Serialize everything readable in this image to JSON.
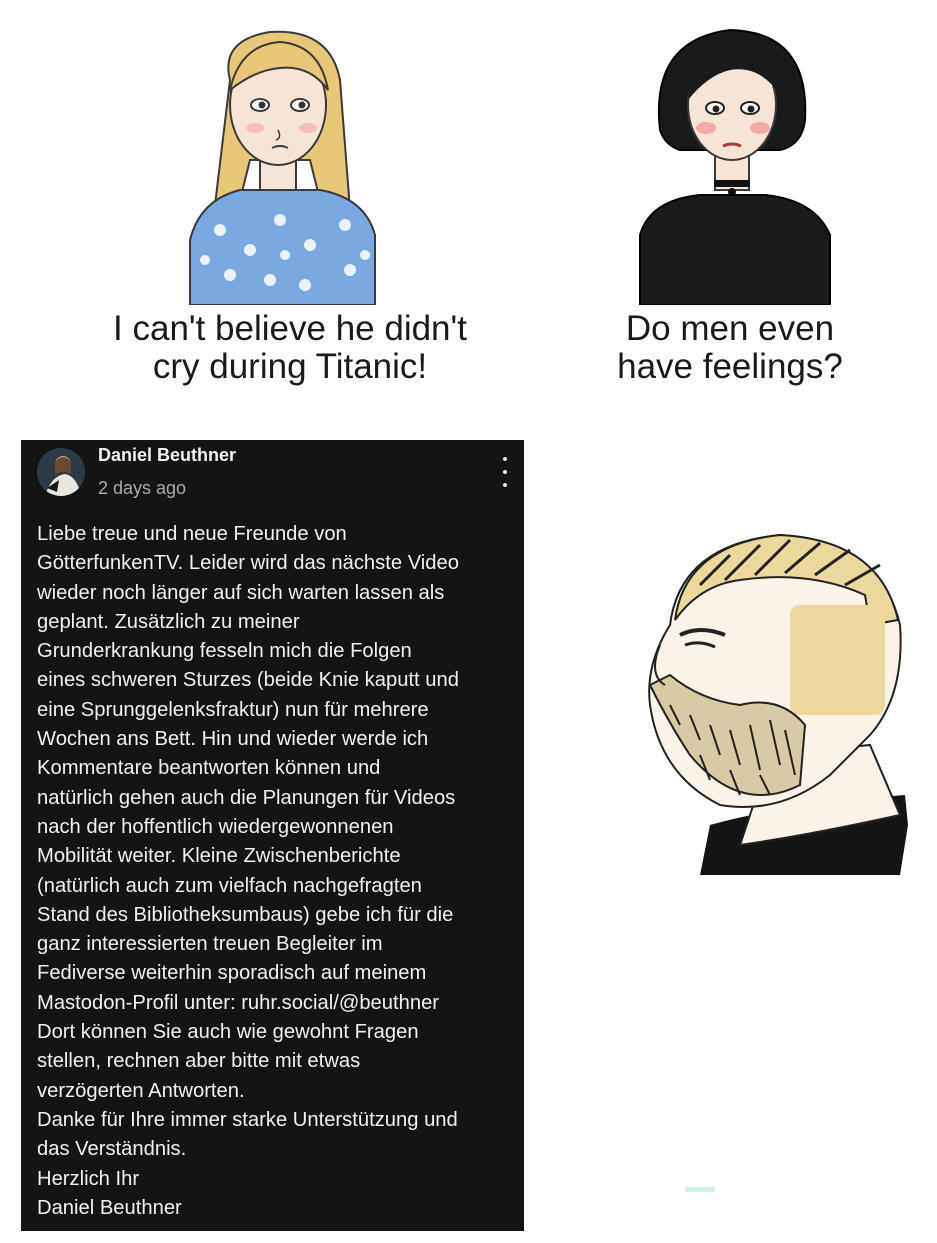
{
  "meme": {
    "panel1_caption": [
      "I can't believe he didn't",
      "cry during Titanic!"
    ],
    "panel2_caption": [
      "Do men even",
      "have feelings?"
    ]
  },
  "post": {
    "author": "Daniel Beuthner",
    "timestamp": "2 days ago",
    "menu_icon": "more-vert-icon",
    "body_lines": [
      "Liebe treue und neue Freunde von",
      "GötterfunkenTV. Leider wird das nächste Video",
      "wieder noch länger auf sich warten lassen als",
      "geplant. Zusätzlich zu meiner",
      "Grunderkrankung fesseln mich die Folgen",
      "eines schweren Sturzes (beide Knie kaputt und",
      "eine Sprunggelenksfraktur) nun für mehrere",
      "Wochen ans Bett. Hin und wieder werde ich",
      "Kommentare beantworten können und",
      "natürlich gehen auch die Planungen für Videos",
      "nach der hoffentlich wiedergewonnenen",
      "Mobilität weiter. Kleine Zwischenberichte",
      "(natürlich auch zum vielfach nachgefragten",
      "Stand des Bibliotheksumbaus) gebe ich für die",
      "ganz interessierten treuen Begleiter im",
      "Fediverse weiterhin sporadisch auf meinem",
      "Mastodon-Profil unter: ruhr.social/@beuthner",
      "Dort können Sie auch wie gewohnt Fragen",
      "stellen, rechnen aber bitte mit etwas",
      "verzögerten Antworten.",
      "Danke für Ihre immer starke Unterstützung und",
      "das Verständnis.",
      "Herzlich Ihr",
      "Daniel Beuthner"
    ]
  },
  "colors": {
    "post_background": "#141414",
    "post_text": "#f1f1f1",
    "timestamp_text": "#aaaaaa"
  }
}
